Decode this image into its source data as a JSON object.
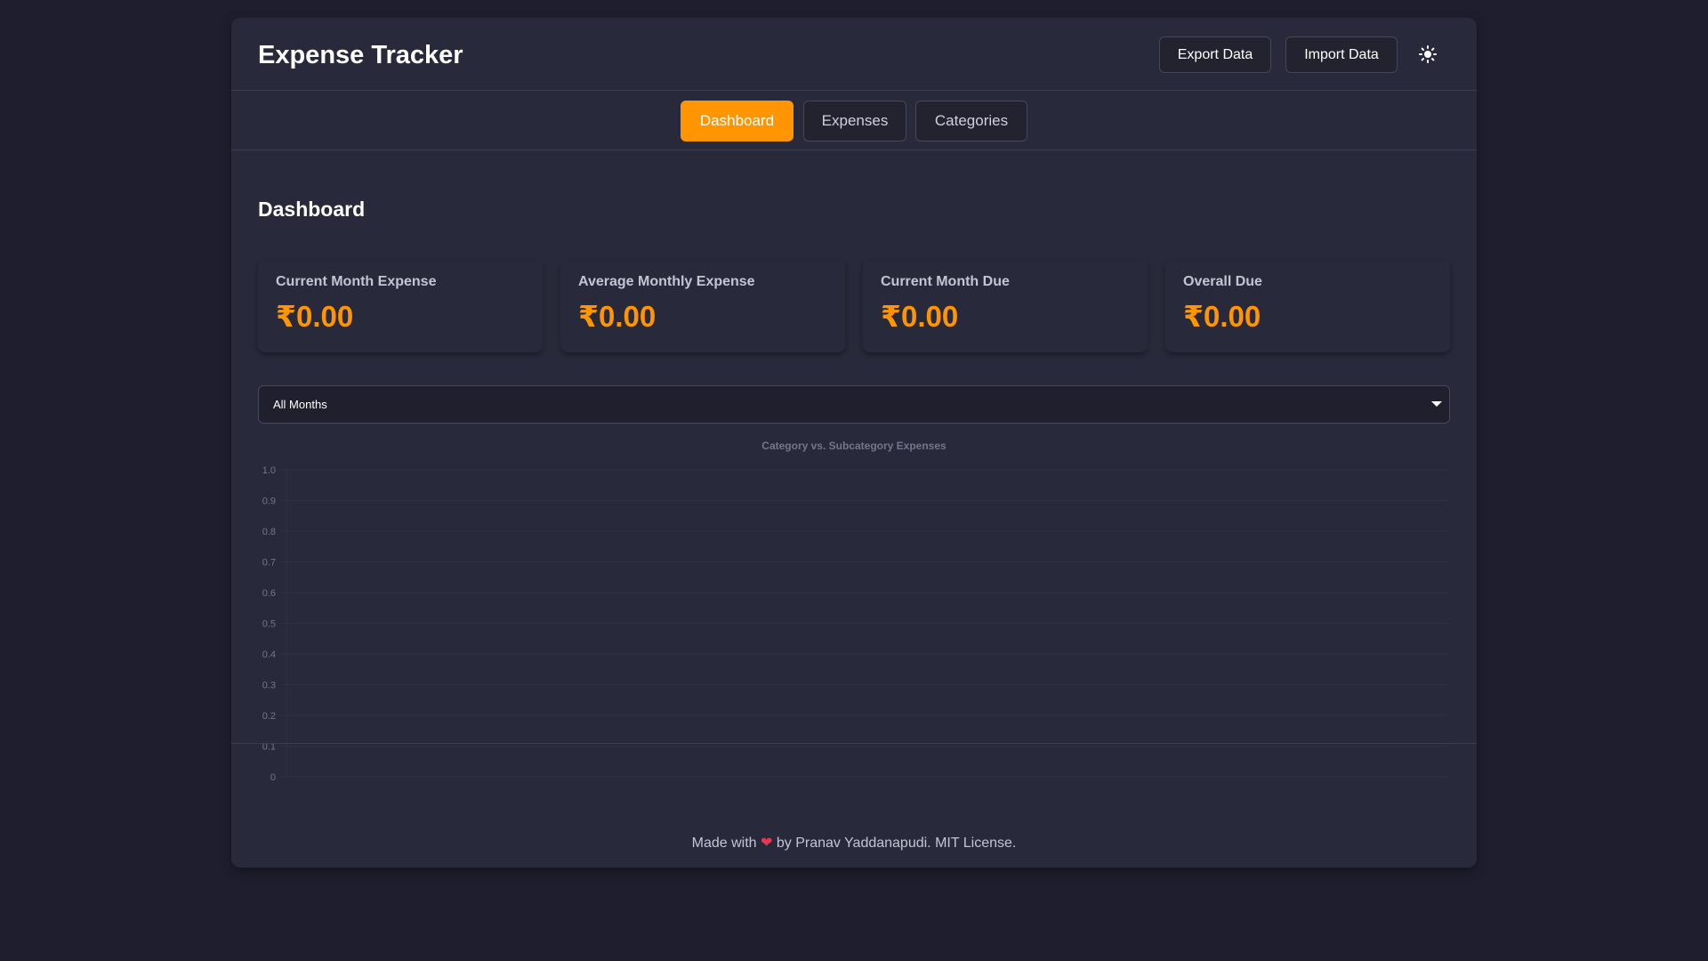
{
  "header": {
    "title": "Expense Tracker",
    "export_label": "Export Data",
    "import_label": "Import Data",
    "theme_icon": "sun-icon"
  },
  "nav": {
    "tabs": [
      {
        "label": "Dashboard",
        "active": true
      },
      {
        "label": "Expenses",
        "active": false
      },
      {
        "label": "Categories",
        "active": false
      }
    ]
  },
  "dashboard": {
    "title": "Dashboard",
    "cards": [
      {
        "label": "Current Month Expense",
        "value": "₹0.00"
      },
      {
        "label": "Average Monthly Expense",
        "value": "₹0.00"
      },
      {
        "label": "Current Month Due",
        "value": "₹0.00"
      },
      {
        "label": "Overall Due",
        "value": "₹0.00"
      }
    ],
    "month_filter": {
      "selected": "All Months"
    }
  },
  "chart_data": {
    "type": "bar",
    "title": "Category vs. Subcategory Expenses",
    "categories": [],
    "series": [],
    "ylim": [
      0,
      1.0
    ],
    "yticks": [
      "0",
      "0.1",
      "0.2",
      "0.3",
      "0.4",
      "0.5",
      "0.6",
      "0.7",
      "0.8",
      "0.9",
      "1.0"
    ],
    "grid": true
  },
  "footer": {
    "prefix": "Made with",
    "heart": "❤",
    "suffix": "by Pranav Yaddanapudi. MIT License."
  },
  "colors": {
    "accent": "#ff9500",
    "background": "#1e1e2e",
    "panel": "#282a3b"
  }
}
